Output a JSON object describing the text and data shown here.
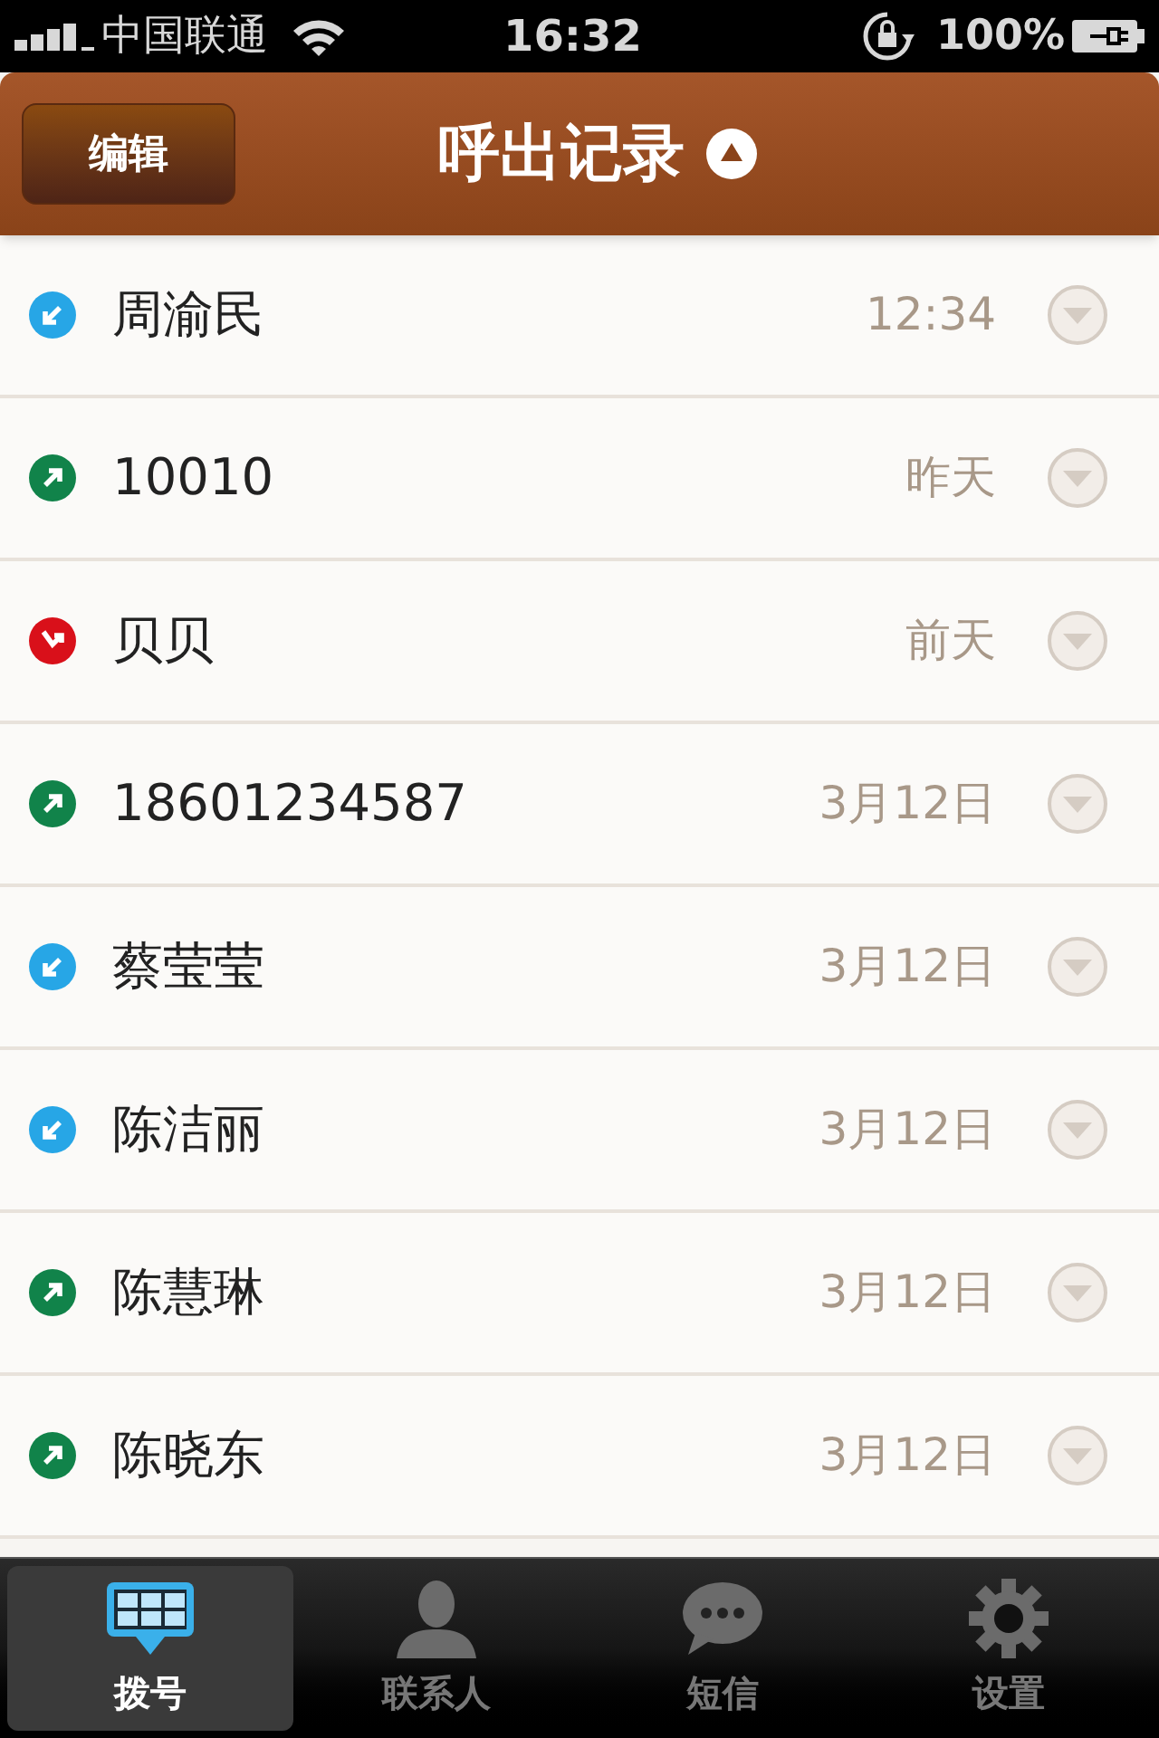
{
  "status_bar": {
    "carrier": "中国联通",
    "time": "16:32",
    "battery": "100%"
  },
  "header": {
    "edit_button": "编辑",
    "title": "呼出记录"
  },
  "calls": [
    {
      "kind": "incoming",
      "name": "周渝民",
      "time": "12:34"
    },
    {
      "kind": "outgoing",
      "name": "10010",
      "time": "昨天"
    },
    {
      "kind": "missed",
      "name": "贝贝",
      "time": "前天"
    },
    {
      "kind": "outgoing",
      "name": "18601234587",
      "time": "3月12日"
    },
    {
      "kind": "incoming",
      "name": "蔡莹莹",
      "time": "3月12日"
    },
    {
      "kind": "incoming",
      "name": "陈洁丽",
      "time": "3月12日"
    },
    {
      "kind": "outgoing",
      "name": "陈慧琳",
      "time": "3月12日"
    },
    {
      "kind": "outgoing",
      "name": "陈晓东",
      "time": "3月12日"
    }
  ],
  "tabs": [
    {
      "kind": "keypad",
      "label": "拨号",
      "selected": true
    },
    {
      "kind": "contacts",
      "label": "联系人",
      "selected": false
    },
    {
      "kind": "messages",
      "label": "短信",
      "selected": false
    },
    {
      "kind": "settings",
      "label": "设置",
      "selected": false
    }
  ]
}
